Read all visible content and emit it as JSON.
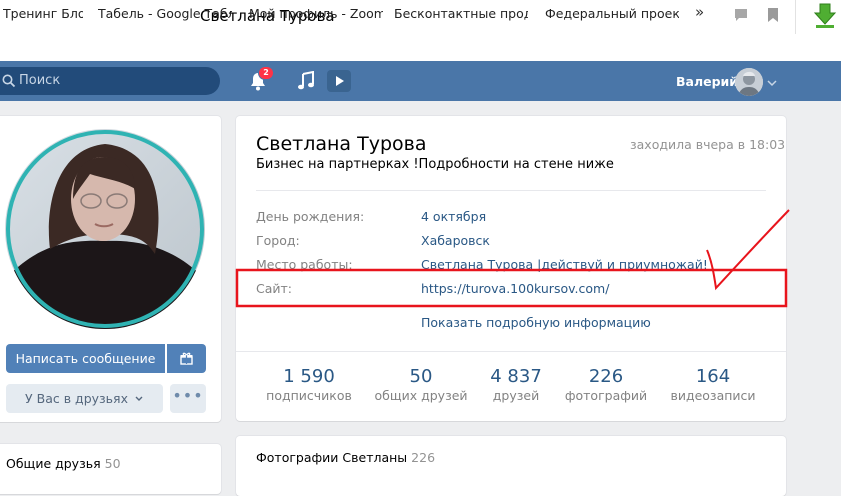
{
  "browser": {
    "window_title": "Светлана Турова",
    "bookmarks": [
      "Тренинг Блог",
      "Табель - Google Табли",
      "Мой профиль - Zoom",
      "Бесконтактные прода",
      "Федеральный проект"
    ],
    "bookmarks_more": "»"
  },
  "header": {
    "search_placeholder": "Поиск",
    "notifications_count": "2",
    "user_name": "Валерий"
  },
  "profile": {
    "name": "Светлана Турова",
    "last_seen": "заходила вчера в 18:03",
    "status": "Бизнес на партнерках !Подробности на стене ниже",
    "info": [
      {
        "label": "День рождения:",
        "value": "4 октября"
      },
      {
        "label": "Город:",
        "value": "Хабаровск"
      },
      {
        "label": "Место работы:",
        "value": "Светлана Турова |действуй и приумножай!"
      },
      {
        "label": "Сайт:",
        "value": "https://turova.100kursov.com/"
      }
    ],
    "more_info": "Показать подробную информацию",
    "stats": [
      {
        "number": "1 590",
        "label": "подписчиков"
      },
      {
        "number": "50",
        "label": "общих друзей"
      },
      {
        "number": "4 837",
        "label": "друзей"
      },
      {
        "number": "226",
        "label": "фотографий"
      },
      {
        "number": "164",
        "label": "видеозаписи"
      }
    ]
  },
  "actions": {
    "message": "Написать сообщение",
    "friends": "У Вас в друзьях",
    "more": "•••"
  },
  "sidebar": {
    "common_friends_label": "Общие друзья",
    "common_friends_count": "50"
  },
  "photos": {
    "title": "Фотографии Светланы",
    "count": "226"
  },
  "colors": {
    "header_bg": "#4a76a8",
    "link": "#2a5885",
    "button": "#5181b8",
    "annotation": "#e8141c"
  }
}
